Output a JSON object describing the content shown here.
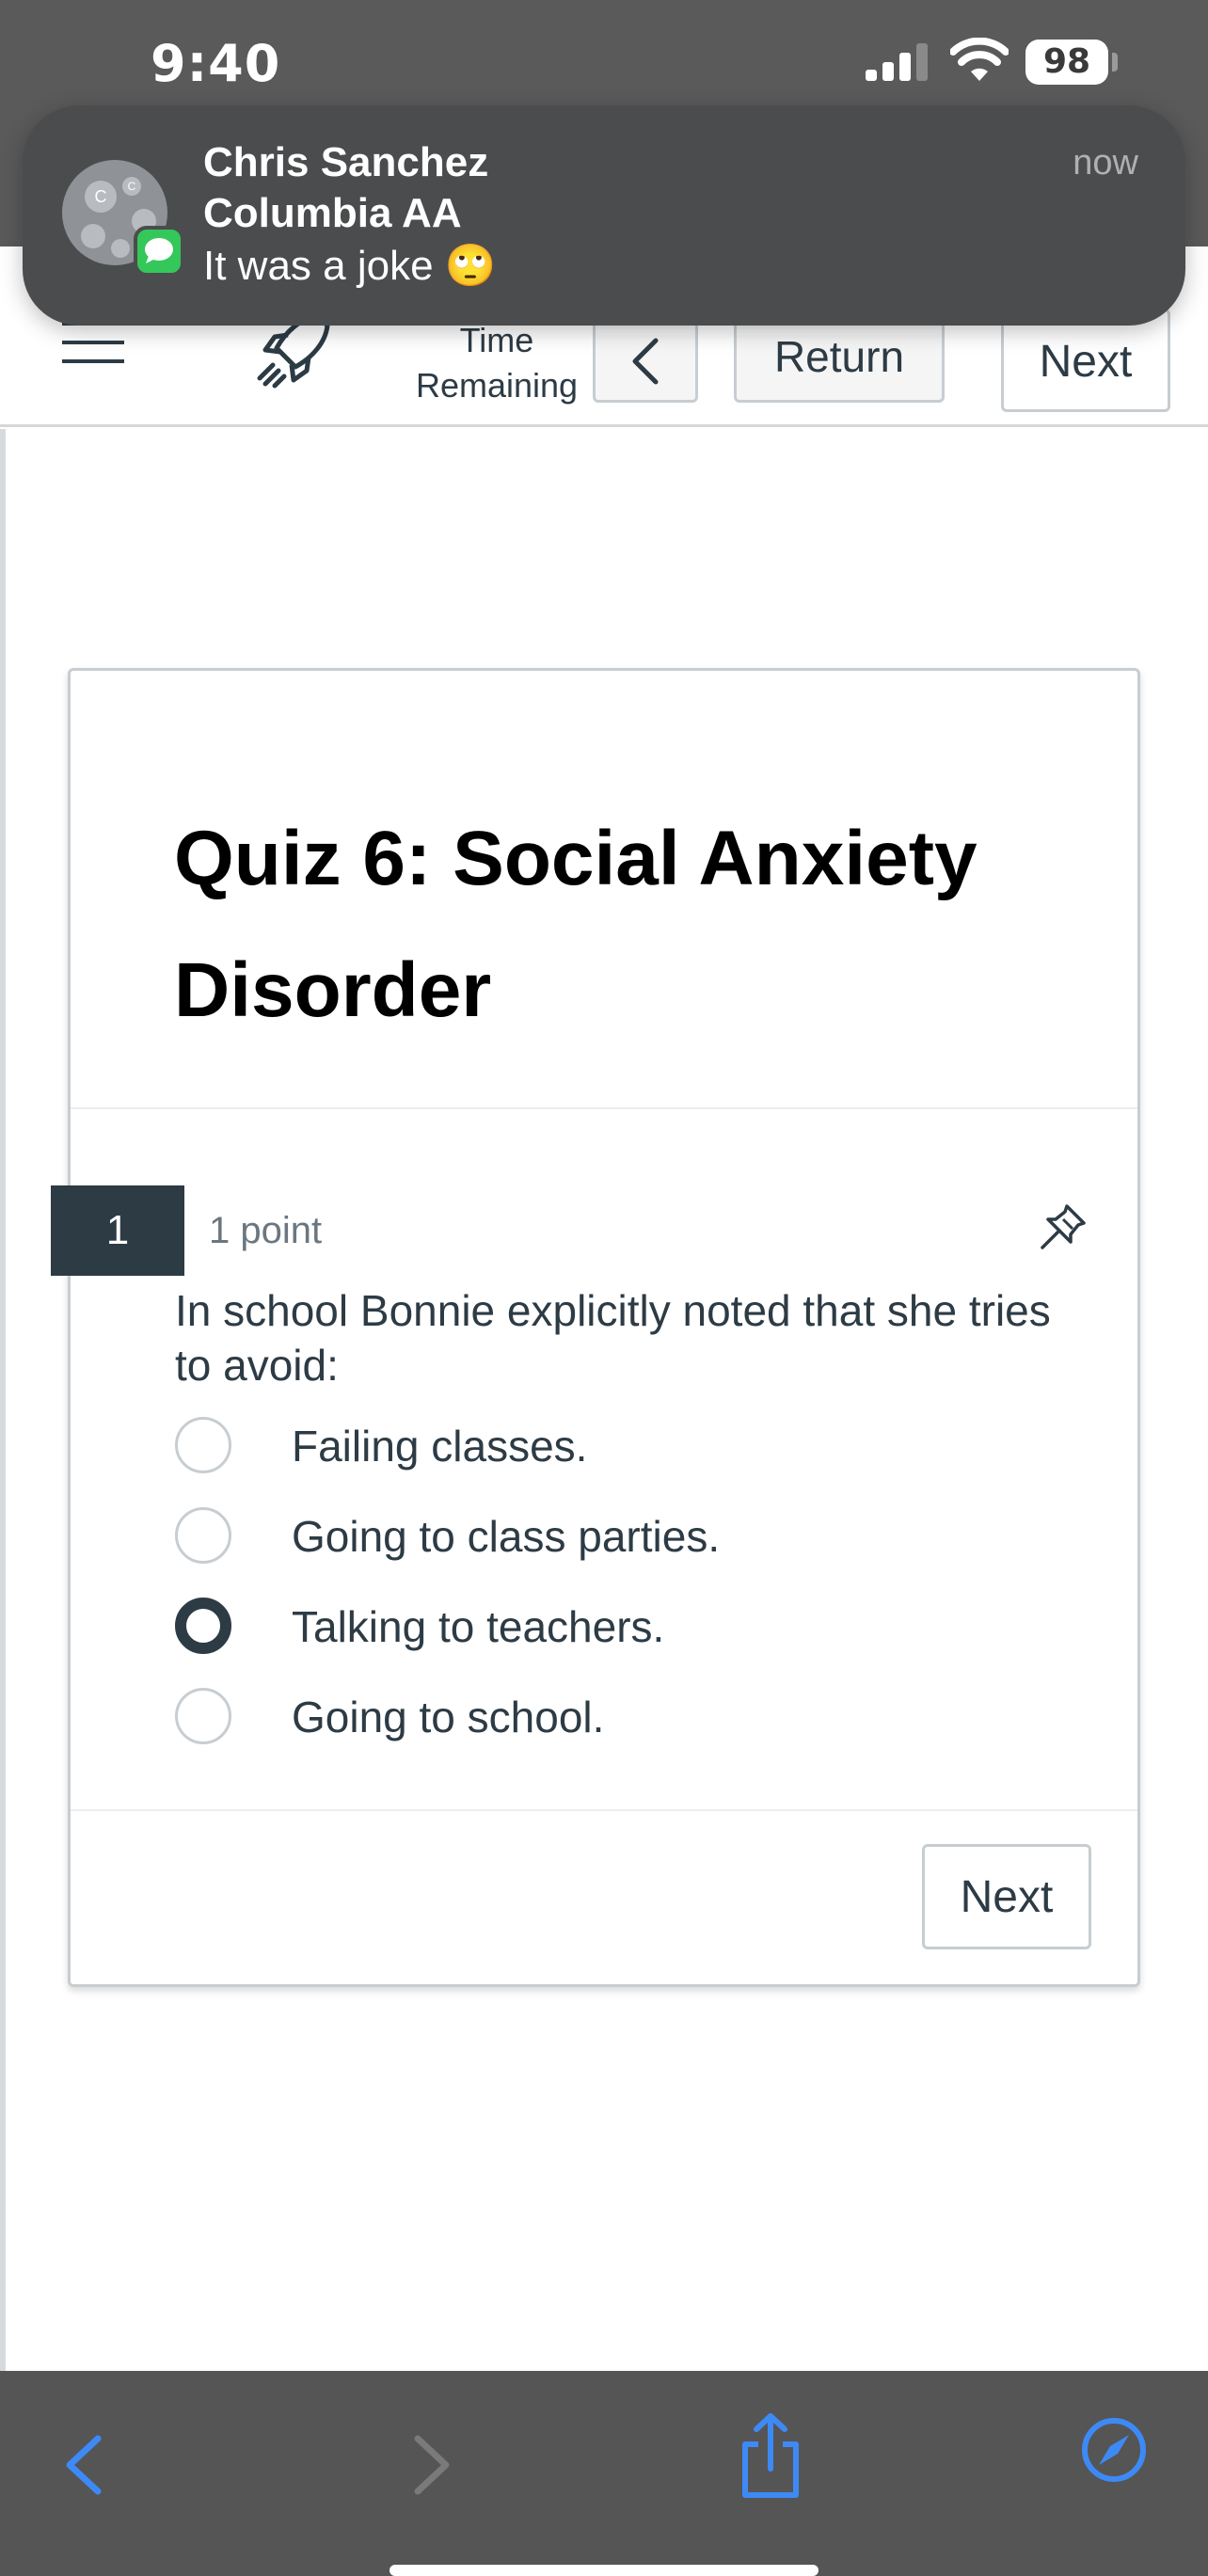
{
  "status_bar": {
    "time": "9:40",
    "battery": "98"
  },
  "notification": {
    "sender": "Chris Sanchez",
    "group": "Columbia AA",
    "message": "It was a joke 🙄",
    "time": "now",
    "avatar_letters": [
      "C",
      "C"
    ],
    "app_icon": "messages-icon"
  },
  "quiz_nav": {
    "menu_icon": "hamburger-menu-icon",
    "rocket_icon": "rocket-icon",
    "time_label": [
      "Time",
      "Remaining"
    ],
    "prev_icon": "chevron-left-icon",
    "return_label": "Return",
    "next_label": "Next"
  },
  "quiz": {
    "title": "Quiz 6: Social Anxiety Disorder",
    "question": {
      "number": "1",
      "points": "1 point",
      "text": "In school Bonnie explicitly noted that she tries to avoid:",
      "options": [
        {
          "label": "Failing classes.",
          "selected": false
        },
        {
          "label": "Going to class parties.",
          "selected": false
        },
        {
          "label": "Talking to teachers.",
          "selected": true
        },
        {
          "label": "Going to school.",
          "selected": false
        }
      ]
    },
    "next_label": "Next"
  },
  "colors": {
    "primary_dark": "#2d3b45",
    "safari_blue": "#3d8af7",
    "messages_green": "#34c759"
  }
}
